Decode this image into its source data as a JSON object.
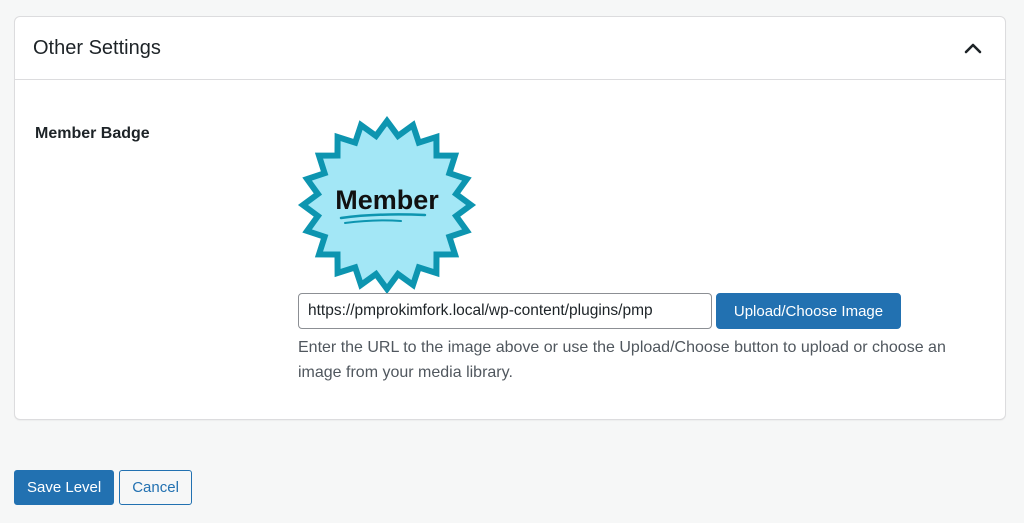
{
  "panel": {
    "title": "Other Settings",
    "toggle_icon": "chevron-up-icon"
  },
  "member_badge": {
    "label": "Member Badge",
    "badge_text": "Member",
    "badge_fill_color": "#a3e7f6",
    "badge_border_color": "#0d95b0",
    "url_value": "https://pmprokimfork.local/wp-content/plugins/pmp",
    "upload_button_label": "Upload/Choose Image",
    "description": "Enter the URL to the image above or use the Upload/Choose button to upload or choose an image from your media library."
  },
  "actions": {
    "save_label": "Save Level",
    "cancel_label": "Cancel"
  },
  "colors": {
    "accent": "#2271b1",
    "background": "#f6f7f7"
  }
}
